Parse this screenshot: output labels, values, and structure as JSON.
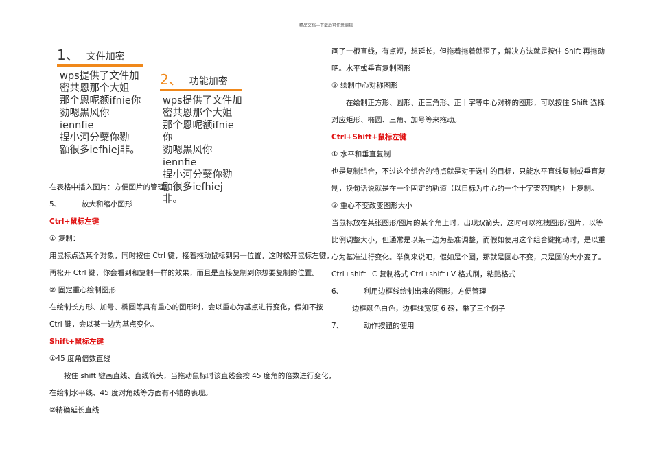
{
  "header": "精品文档---下载后可任意编辑",
  "figures": [
    {
      "num": "1、",
      "title": "文件加密",
      "lines": [
        "wps提供了文件加",
        "密共恩那个大姐",
        "那个恩呢额ifnie你",
        "勠嗯黑风你iennfie",
        "捏小河分蘖你勠",
        "额很多iefhiej非。"
      ]
    },
    {
      "num": "2、",
      "title": "功能加密",
      "lines": [
        "wps提供了文件加",
        "密共恩那个大姐",
        "那个恩呢额ifnie你",
        "勠嗯黑风你iennfie",
        "捏小河分蘖你勠",
        "额很多iefhiej非。"
      ]
    }
  ],
  "left": [
    {
      "text": "在表格中插入图片：方便图片的管理。"
    },
    {
      "num": "5、",
      "text": "放大和缩小图形"
    },
    {
      "text": "Ctrl+鼠标左键",
      "style": "red"
    },
    {
      "text": "① 复制："
    },
    {
      "text": "用鼠标点选某个对象，同时按住 Ctrl 键，接着拖动鼠标到另一位置，这时松开鼠标左键，"
    },
    {
      "text": "再松开 Ctrl 键，你会看到和复制一样的效果，而且是直接复制到你想要复制的位置。"
    },
    {
      "text": "② 固定重心绘制图形"
    },
    {
      "text": "在绘制长方形、加号、椭圆等具有重心的图形时，会以重心为基点进行变化，假如不按"
    },
    {
      "text": "Ctrl 键，会以某一边为基点变化。"
    },
    {
      "text": "Shift+鼠标左键",
      "style": "red"
    },
    {
      "text": "①45 度角倍数直线"
    },
    {
      "text": "按住 shift 键画直线、直线箭头，当拖动鼠标时该直线会按 45 度角的倍数进行变化，",
      "style": "ind"
    },
    {
      "text": "在绘制水平线、45 度对角线等方面有不错的表现。"
    },
    {
      "text": "②精确延长直线"
    }
  ],
  "right": [
    {
      "text": "画了一根直线，有点短，想延长，但拖着拖着就歪了，解决方法就是按住 Shift 再拖动"
    },
    {
      "text": "吧。水平或垂直复制图形"
    },
    {
      "text": "③ 绘制中心对称图形"
    },
    {
      "text": "在绘制正方形、圆形、正三角形、正十字等中心对称的图形，可以按住 Shift 选择",
      "style": "ind"
    },
    {
      "text": "对应矩形、椭圆、三角、加号等来拖动。"
    },
    {
      "text": "Ctrl+Shift+鼠标左键",
      "style": "red"
    },
    {
      "text": "① 水平和垂直复制"
    },
    {
      "text": "也是复制组合，不过这个组合的特点就是对于选中的目标，只能水平直线复制或垂直复"
    },
    {
      "text": "制，换句话说就是在一个固定的轨道（以目标为中心的一个十字架范围内）上复制。"
    },
    {
      "text": "② 重心不变改变图形大小"
    },
    {
      "text": "当鼠标放在某张图形/图片的某个角上时，出现双箭头，这时可以拖拽图形/图片，以等"
    },
    {
      "text": "比例调整大小，但通常是以某一边为基准调整，而假如使用这个组合键拖动时，是以重"
    },
    {
      "text": "心为基准进行变化。举例来说吧，假如是个圆，那就是圆心不变，只是圆的大小变了。"
    },
    {
      "text": "Ctrl+shift+C 复制格式 Ctrl+shift+V 格式刷，粘贴格式"
    },
    {
      "num": "6、",
      "text": "利用边框线绘制出来的图形，方便管理"
    },
    {
      "text": "边框颜色白色，边框线宽度 6 磅，举了三个例子",
      "style": "ind2"
    },
    {
      "num": "7、",
      "text": "动作按钮的使用"
    }
  ]
}
